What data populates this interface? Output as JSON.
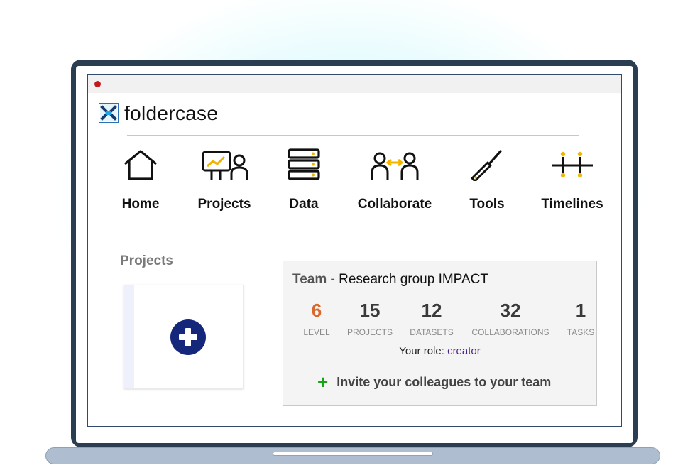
{
  "app": {
    "brand": "foldercase"
  },
  "nav": [
    {
      "label": "Home",
      "icon": "home-icon"
    },
    {
      "label": "Projects",
      "icon": "presentation-icon"
    },
    {
      "label": "Data",
      "icon": "database-icon"
    },
    {
      "label": "Collaborate",
      "icon": "collaborate-icon"
    },
    {
      "label": "Tools",
      "icon": "tool-icon"
    },
    {
      "label": "Timelines",
      "icon": "timeline-icon"
    }
  ],
  "projects": {
    "section_title": "Projects",
    "add_icon": "plus-circle-icon"
  },
  "team": {
    "prefix": "Team - ",
    "name": "Research group IMPACT",
    "stats": [
      {
        "value": "6",
        "caption": "LEVEL",
        "color": "#d9682b"
      },
      {
        "value": "15",
        "caption": "PROJECTS"
      },
      {
        "value": "12",
        "caption": "DATASETS"
      },
      {
        "value": "32",
        "caption": "COLLABORATIONS"
      },
      {
        "value": "1",
        "caption": "TASKS"
      }
    ],
    "role_label": "Your role:",
    "role_value": "creator",
    "invite_label": "Invite your colleagues to your team"
  },
  "colors": {
    "accent": "#15277a",
    "level": "#d9682b",
    "role": "#4d1f85",
    "invite_plus": "#1aa31a",
    "timeline_dots": "#f2b705"
  }
}
